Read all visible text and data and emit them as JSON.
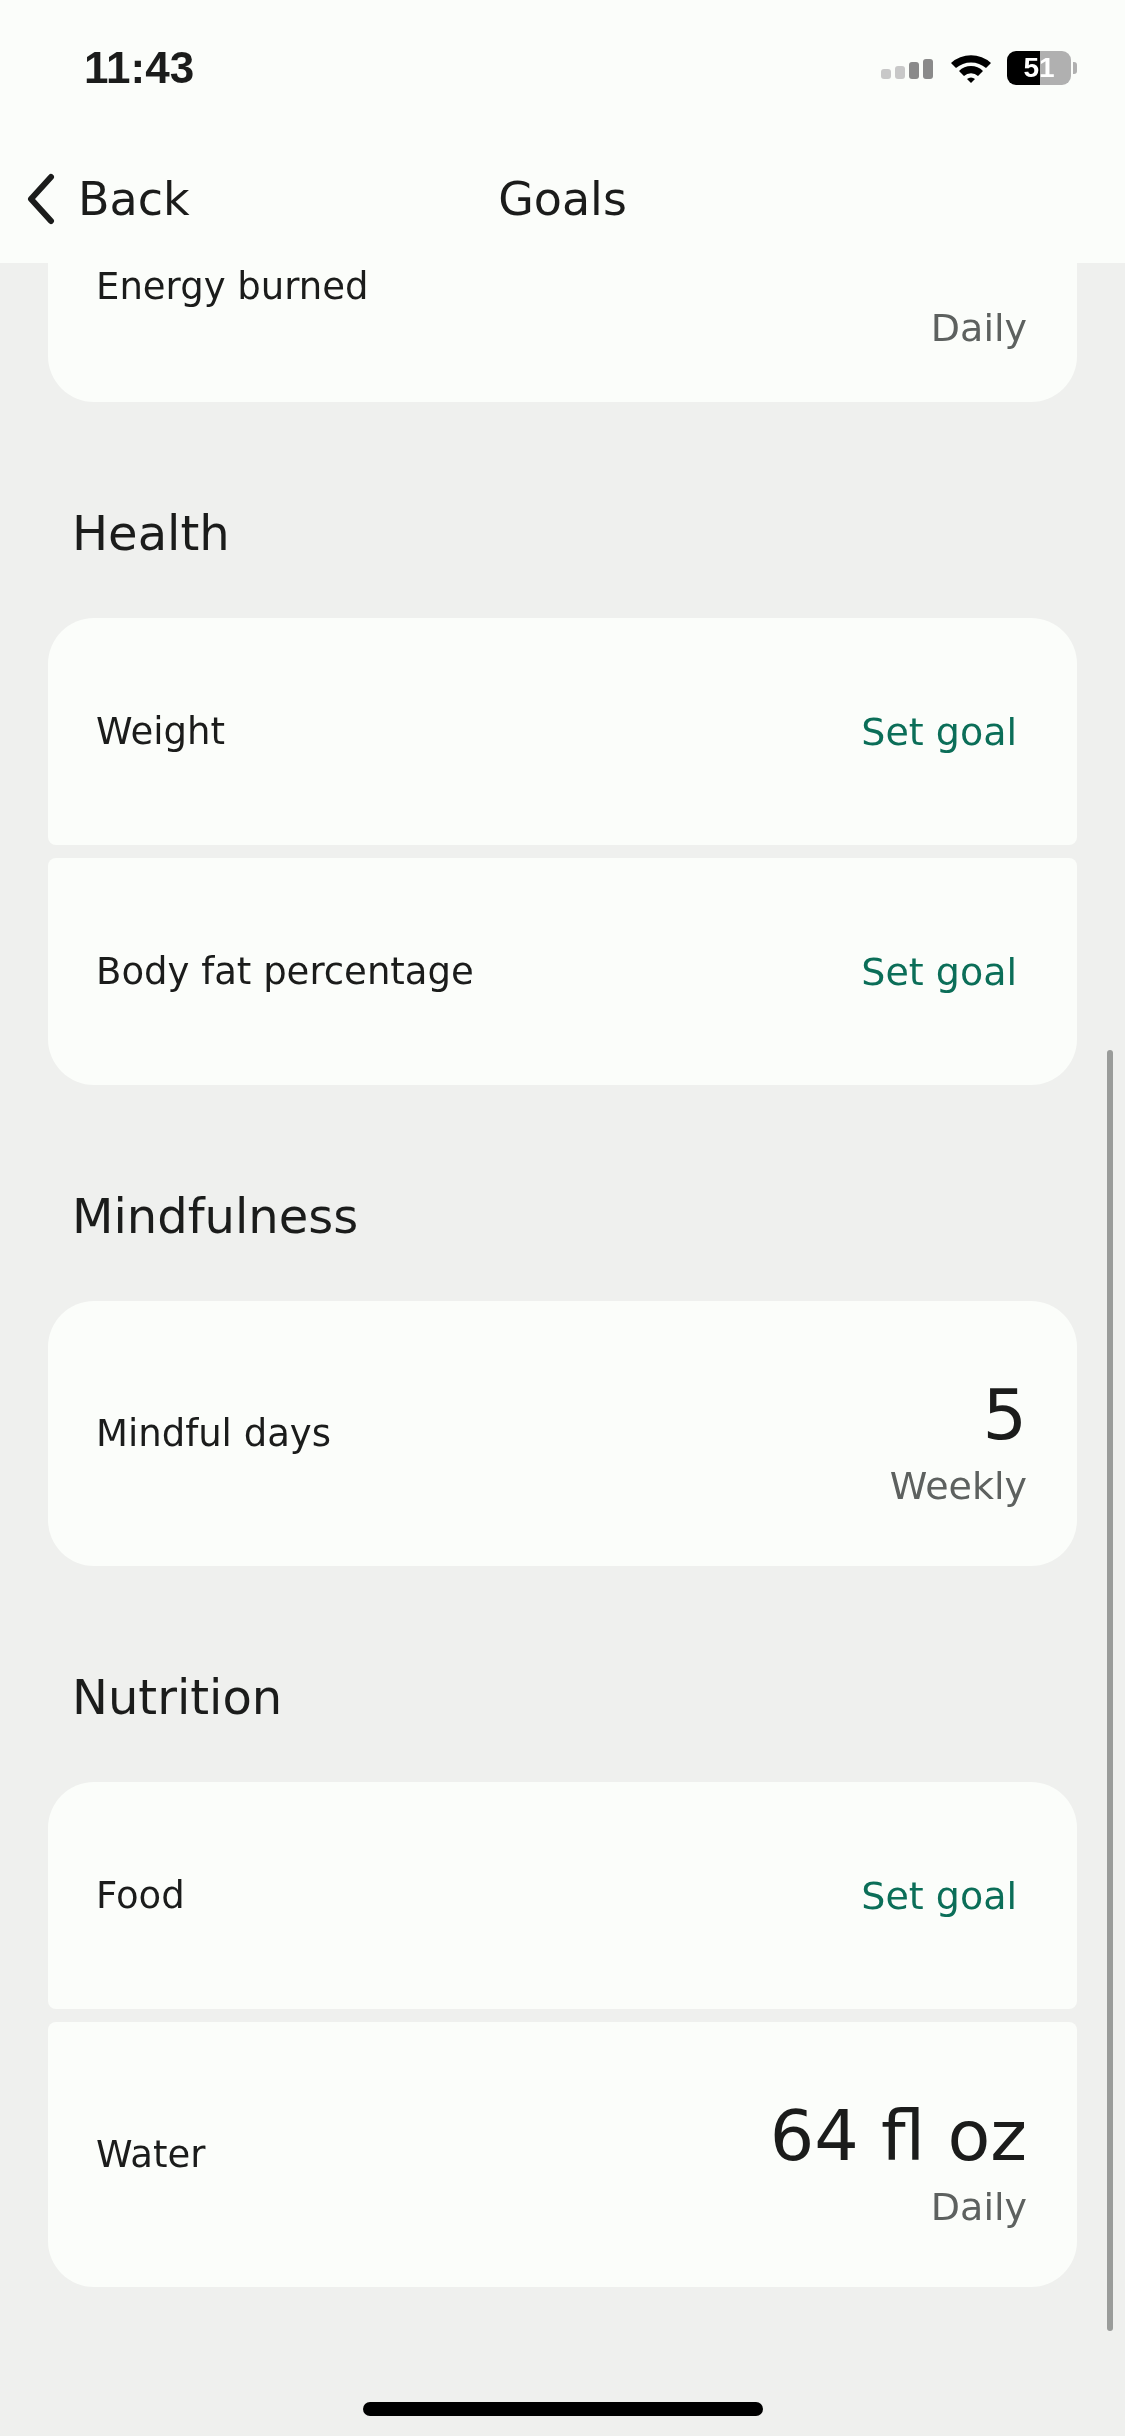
{
  "status_bar": {
    "time": "11:43",
    "battery": "51"
  },
  "nav": {
    "back": "Back",
    "title": "Goals"
  },
  "top_card": {
    "label": "Energy burned",
    "period": "Daily"
  },
  "sections": [
    {
      "title": "Health",
      "items": [
        {
          "kind": "set_goal",
          "label": "Weight",
          "action": "Set goal"
        },
        {
          "kind": "set_goal",
          "label": "Body fat percentage",
          "action": "Set goal"
        }
      ]
    },
    {
      "title": "Mindfulness",
      "items": [
        {
          "kind": "value",
          "label": "Mindful days",
          "value": "5",
          "period": "Weekly"
        }
      ]
    },
    {
      "title": "Nutrition",
      "items": [
        {
          "kind": "set_goal",
          "label": "Food",
          "action": "Set goal"
        },
        {
          "kind": "value",
          "label": "Water",
          "value": "64 fl oz",
          "period": "Daily"
        }
      ]
    }
  ]
}
